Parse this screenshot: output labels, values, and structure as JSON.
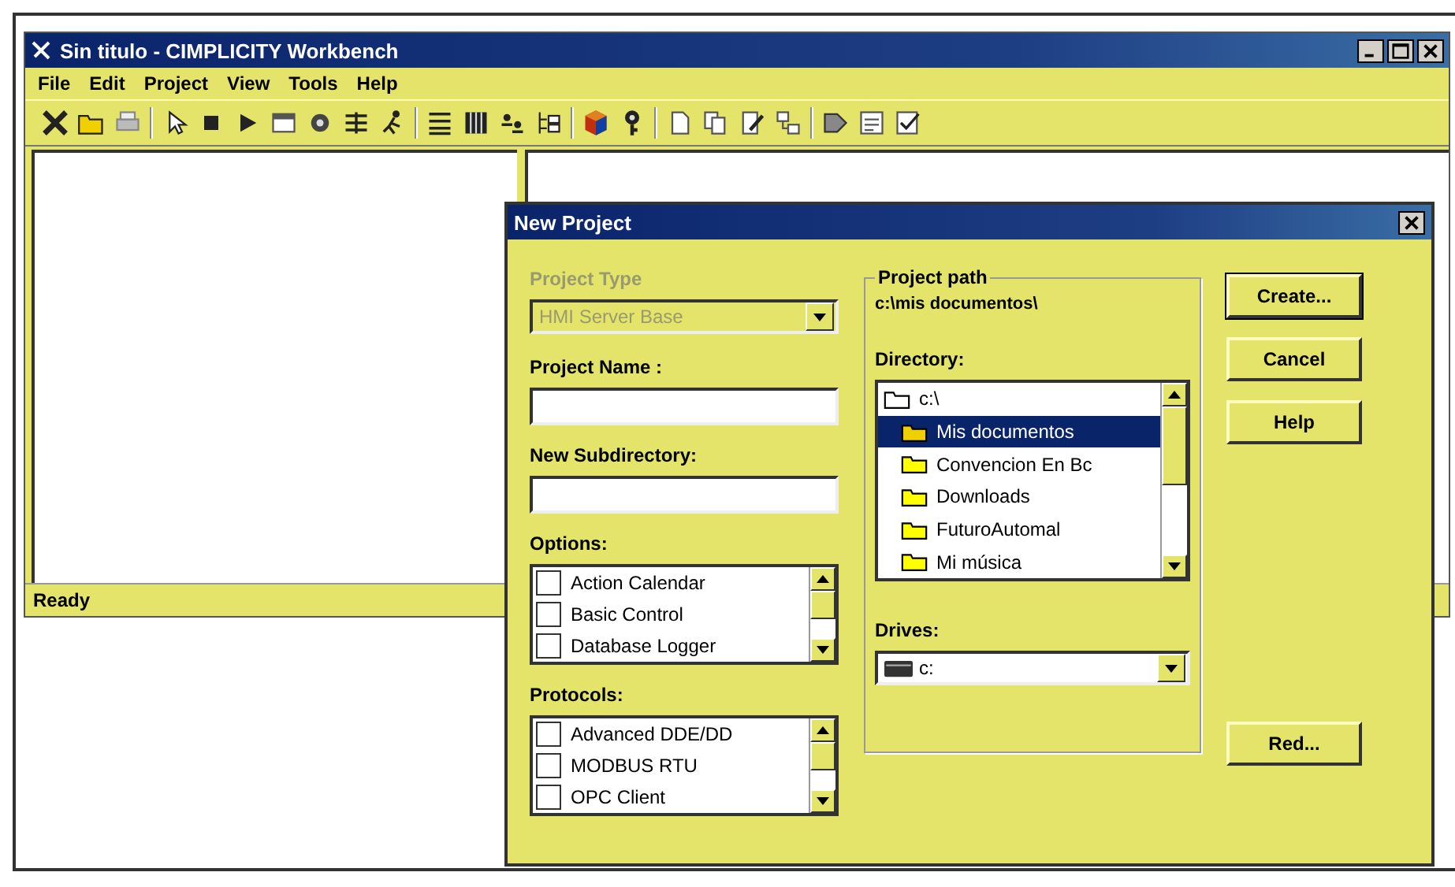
{
  "window": {
    "title": "Sin titulo - CIMPLICITY Workbench"
  },
  "menu": [
    "File",
    "Edit",
    "Project",
    "View",
    "Tools",
    "Help"
  ],
  "status_bar": {
    "text": "Ready"
  },
  "dialog": {
    "title": "New Project",
    "project_type": {
      "label": "Project Type",
      "value": "HMI Server Base",
      "disabled": true
    },
    "project_name": {
      "label": "Project Name :"
    },
    "new_subdirectory": {
      "label": "New Subdirectory:"
    },
    "options": {
      "label": "Options:",
      "items": [
        {
          "label": "Action Calendar",
          "checked": false
        },
        {
          "label": "Basic Control",
          "checked": false
        },
        {
          "label": "Database Logger",
          "checked": false
        }
      ]
    },
    "protocols": {
      "label": "Protocols:",
      "items": [
        {
          "label": "Advanced DDE/DD",
          "checked": false
        },
        {
          "label": "MODBUS RTU",
          "checked": false
        },
        {
          "label": "OPC Client",
          "checked": false
        }
      ]
    },
    "project_path": {
      "label": "Project path",
      "value": "c:\\mis documentos\\"
    },
    "directory": {
      "label": "Directory:",
      "items": [
        {
          "label": "c:\\",
          "selected": false,
          "children": [
            {
              "label": "Mis documentos",
              "selected": true
            },
            {
              "label": "Convencion En Bc",
              "selected": false
            },
            {
              "label": "Downloads",
              "selected": false
            },
            {
              "label": "FuturoAutomal",
              "selected": false
            },
            {
              "label": "Mi música",
              "selected": false
            }
          ]
        }
      ]
    },
    "drives": {
      "label": "Drives:",
      "value": "c:"
    },
    "buttons": [
      {
        "label": "Create...",
        "default": true
      },
      {
        "label": "Cancel",
        "default": false
      },
      {
        "label": "Help",
        "default": false
      },
      {
        "label": "Red...",
        "default": false
      }
    ]
  }
}
